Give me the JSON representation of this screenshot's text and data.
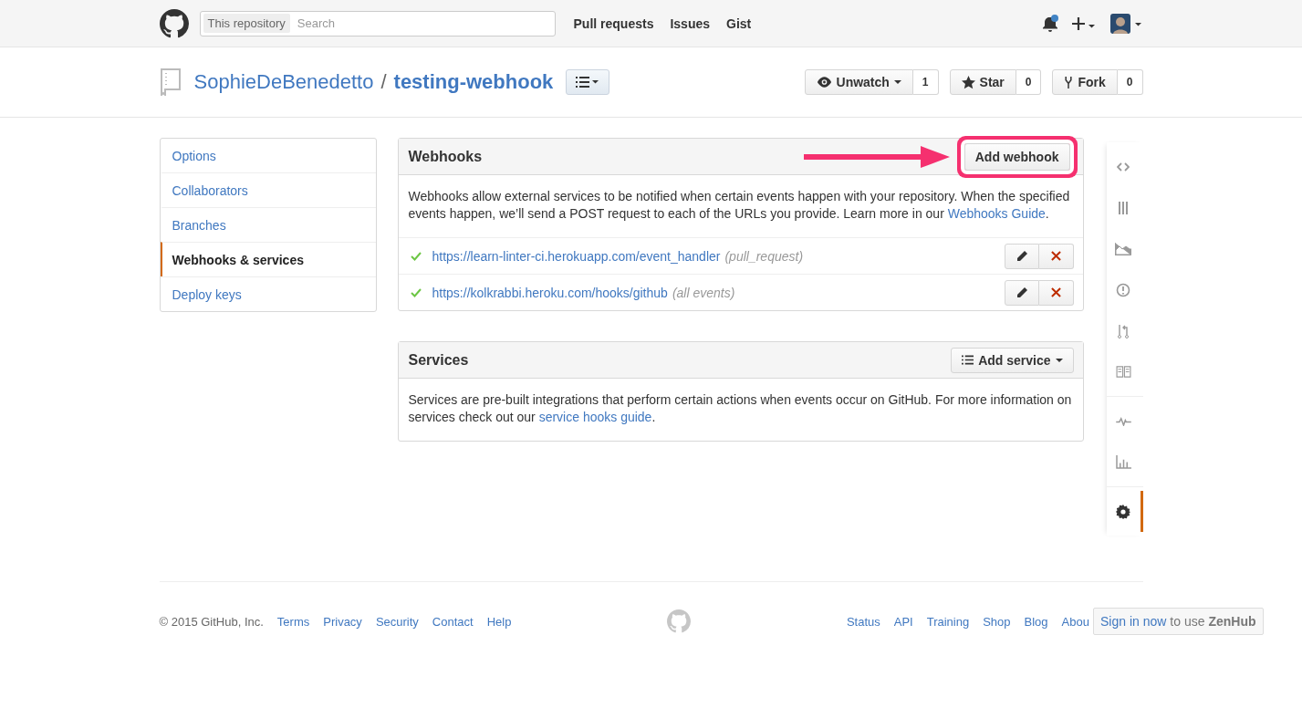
{
  "header": {
    "search_scope": "This repository",
    "search_placeholder": "Search",
    "nav": [
      "Pull requests",
      "Issues",
      "Gist"
    ],
    "notifications_unread": true
  },
  "repo": {
    "owner": "SophieDeBenedetto",
    "separator": "/",
    "name": "testing-webhook",
    "actions": [
      {
        "label": "Unwatch",
        "count": "1",
        "dropdown": true
      },
      {
        "label": "Star",
        "count": "0",
        "dropdown": false
      },
      {
        "label": "Fork",
        "count": "0",
        "dropdown": false
      }
    ]
  },
  "settings_menu": [
    {
      "label": "Options",
      "selected": false
    },
    {
      "label": "Collaborators",
      "selected": false
    },
    {
      "label": "Branches",
      "selected": false
    },
    {
      "label": "Webhooks & services",
      "selected": true
    },
    {
      "label": "Deploy keys",
      "selected": false
    }
  ],
  "webhooks": {
    "title": "Webhooks",
    "button": "Add webhook",
    "description": "Webhooks allow external services to be notified when certain events happen with your repository. When the specified events happen, we’ll send a POST request to each of the URLs you provide. Learn more in our ",
    "guide_link": "Webhooks Guide",
    "description_end": ".",
    "hooks": [
      {
        "url": "https://learn-linter-ci.herokuapp.com/event_handler",
        "events": "(pull_request)",
        "ok": true
      },
      {
        "url": "https://kolkrabbi.heroku.com/hooks/github",
        "events": "(all events)",
        "ok": true
      }
    ]
  },
  "services": {
    "title": "Services",
    "button": "Add service",
    "description": "Services are pre-built integrations that perform certain actions when events occur on GitHub. For more information on services check out our ",
    "guide_link": "service hooks guide",
    "description_end": "."
  },
  "repo_nav": [
    [
      {
        "selected": false
      },
      {
        "selected": false
      },
      {
        "selected": false
      },
      {
        "selected": false
      },
      {
        "selected": false
      },
      {
        "selected": false
      }
    ],
    [
      {
        "selected": false
      },
      {
        "selected": false
      }
    ],
    [
      {
        "selected": true
      }
    ]
  ],
  "footer": {
    "copyright": "© 2015 GitHub, Inc.",
    "left_links": [
      "Terms",
      "Privacy",
      "Security",
      "Contact",
      "Help"
    ],
    "right_links": [
      "Status",
      "API",
      "Training",
      "Shop",
      "Blog",
      "Abou"
    ],
    "zenhub": {
      "link": "Sign in now",
      "rest": "to use **ZenHub**"
    }
  }
}
